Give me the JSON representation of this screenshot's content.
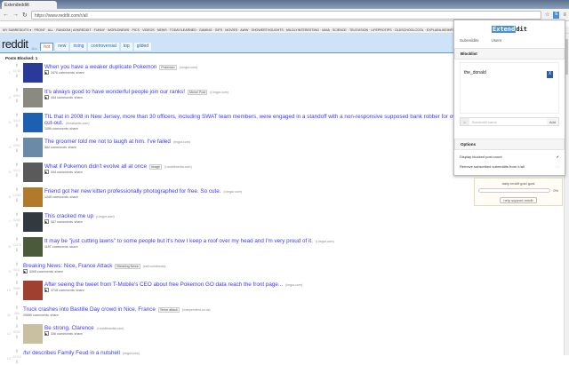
{
  "browser": {
    "tab_title": "Extendedditt",
    "url": "https://www.reddit.com/r/all"
  },
  "subreddit_bar": "MY SUBREDDITS ▾ · FRONT · ALL · RANDOM | ASKREDDIT · FUNNY · WORLDNEWS · PICS · VIDEOS · NEWS · TODAYILEARNED · GAMING · GIFS · MOVIES · AWW · SHOWERTHOUGHTS · MILDLYINTERESTING · IAMA · SCIENCE · TELEVISION · LIFEPROTIPS · OLDSCHOOLCOOL · EXPLAINLIKEIMFIVE · DIY",
  "header": {
    "logo": "reddit",
    "sub": "ALL",
    "tabs": [
      "hot",
      "new",
      "rising",
      "controversial",
      "top",
      "gilded"
    ]
  },
  "posts_blocked": "Posts Blocked: 1",
  "posts": [
    {
      "rank": "1",
      "score": "10.5k",
      "title": "When you have a weaker duplicate Pokemon",
      "flair": "Pokemon",
      "domain": "(i.imgur.com)",
      "comments": "2476 comments",
      "share": "share",
      "thumb": "#2a3a9a",
      "play": true
    },
    {
      "rank": "2",
      "score": "5504",
      "title": "It's always good to have wonderful people join our ranks!",
      "flair": "Meme Post",
      "domain": "(i.imgur.com)",
      "comments": "444 comments",
      "share": "share",
      "thumb": "#8a8a80",
      "play": true
    },
    {
      "rank": "3",
      "score": "5419",
      "title": "TIL that in 2008 in New Jersey, more than 30 officers, including SWAT team members, were engaged in a standoff with a non-responsive supposed bank robber for over a ... before realizing 'she' was a cardboard cut-out.",
      "flair": "",
      "domain": "(theatlantic.com)",
      "comments": "1250 comments",
      "share": "share",
      "thumb": "#1d5fb0",
      "play": false
    },
    {
      "rank": "4",
      "score": "5394",
      "title": "The groomer told me not to laugh at him. I've failed",
      "flair": "",
      "domain": "(imgur.com)",
      "comments": "382 comments",
      "share": "share",
      "thumb": "#6b8aa8",
      "play": false
    },
    {
      "rank": "5",
      "score": "5414",
      "title": "What if Pokemon didn't evolve all at once",
      "flair": "Image",
      "domain": "(i.redditmedia.com)",
      "comments": "344 comments",
      "share": "share",
      "thumb": "#5a5a5a",
      "play": true
    },
    {
      "rank": "6",
      "score": "12083",
      "title": "Friend got her new kitten professionally photographed for free. So cute.",
      "flair": "",
      "domain": "(i.imgur.com)",
      "comments": "1245 comments",
      "share": "share",
      "thumb": "#b07a2a",
      "play": false
    },
    {
      "rank": "7",
      "score": "8285",
      "title": "This cracked me up",
      "flair": "",
      "domain": "(i.imgur.com)",
      "comments": "337 comments",
      "share": "share",
      "thumb": "#303a40",
      "play": true
    },
    {
      "rank": "8",
      "score": "12376",
      "title": "It may be \"just cutting lawns\" to some people but it's how I keep a roof over my head and I'm very proud of it.",
      "flair": "",
      "domain": "(i.imgur.com)",
      "comments": "1197 comments",
      "share": "share",
      "thumb": "#4a5a3a",
      "play": false
    },
    {
      "rank": "9",
      "score": "9411",
      "title": "Breaking News: Nice, France Attack",
      "flair": "Breaking News",
      "domain": "(self.worldnews)",
      "comments": "3265 comments",
      "share": "share",
      "thumb": "",
      "play": true
    },
    {
      "rank": "10",
      "score": "5589",
      "title": "After seeing the tweet from T-Mobile's CEO about free Pokemon GO data reach the front page...",
      "flair": "",
      "domain": "(imgur.com)",
      "comments": "4718 comments",
      "share": "share",
      "thumb": "#a04030",
      "play": true
    },
    {
      "rank": "11",
      "score": "46k",
      "title": "Truck crashes into Bastille Day crowd in Nice, France",
      "flair": "Terror attack",
      "domain": "(independent.co.uk)",
      "comments": "20895 comments",
      "share": "share",
      "thumb": "",
      "play": false
    },
    {
      "rank": "12",
      "score": "8293",
      "title": "Be strong, Clarence",
      "flair": "",
      "domain": "(i.redditmedia.com)",
      "comments": "338 comments",
      "share": "share",
      "thumb": "#c8c0a0",
      "play": true
    },
    {
      "rank": "13",
      "score": "20110",
      "title": "/tv/ describes Family Feud in a nutshell",
      "flair": "",
      "domain": "(imgur.com)",
      "comments": "",
      "share": "",
      "thumb": "",
      "play": false
    }
  ],
  "extension": {
    "title_a": "Extend",
    "title_b": "dit",
    "tabs": [
      "Subreddits",
      "Users"
    ],
    "blocklist_label": "Blocklist",
    "blocked_items": [
      "the_donald"
    ],
    "remove_label": "X",
    "prefix": "/r/",
    "input_placeholder": "Subreddit name",
    "add_label": "Add",
    "options_label": "Options",
    "options": [
      {
        "label": "Display blocked post count",
        "checked": true
      },
      {
        "label": "Remove subscribed subreddits from /r/all",
        "checked": false
      }
    ]
  },
  "gold": {
    "label": "daily reddit gold goal",
    "percent": "0%",
    "value": 0,
    "button": "help support reddit"
  }
}
